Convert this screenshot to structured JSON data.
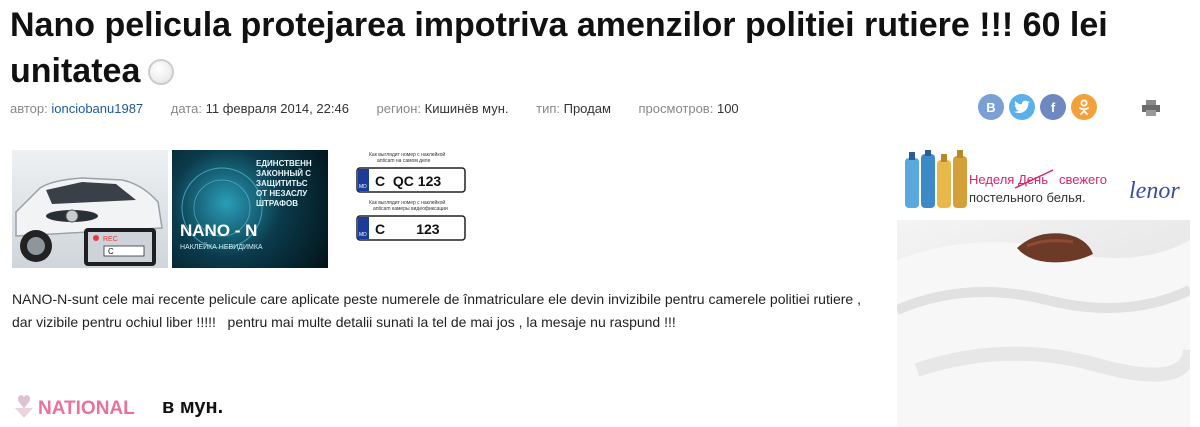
{
  "title": "Nano pelicula protejarea impotriva amenzilor politiei rutiere !!! 60 lei unitatea",
  "meta": {
    "author_label": "автор:",
    "author": "ionciobanu1987",
    "date_label": "дата:",
    "date": "11 февраля 2014, 22:46",
    "region_label": "регион:",
    "region": "Кишинёв мун.",
    "type_label": "тип:",
    "type": "Продам",
    "views_label": "просмотров:",
    "views": "100"
  },
  "share": [
    {
      "icon": "vk-icon",
      "label": "B",
      "color": "#7aa0d4"
    },
    {
      "icon": "twitter-icon",
      "label": "t",
      "color": "#5ab0e8"
    },
    {
      "icon": "facebook-icon",
      "label": "f",
      "color": "#6f88c0"
    },
    {
      "icon": "odnoklassniki-icon",
      "label": "ok",
      "color": "#f4a13b"
    }
  ],
  "images": {
    "nano_text": [
      "ЕДИНСТВЕНН",
      "ЗАКОННЫЙ С",
      "ЗАЩИТИТЬС",
      "ОТ НЕЗАСЛУ",
      "ШТРАФОВ"
    ],
    "nano_logo": "NANO - N",
    "nano_sub": "НАКЛЕЙКА НЕВИДИМКА",
    "car_plate": "C",
    "rec": "REC",
    "plate1_caption1": "Как выглядит номер с наклейкой",
    "plate1_caption2": "anticam на самом деле",
    "plate1_text": "C  QC 123",
    "plate2_caption1": "Как выглядит номер с наклейкой",
    "plate2_caption2": "anticam камеры видеофиксации",
    "plate2_text": "C        123",
    "plate_code": "MD"
  },
  "description": "NANO-N-sunt cele mai recente pelicule care aplicate peste numerele de înmatriculare ele devin invizibile pentru camerele politiei rutiere , dar vizibile pentru ochiul liber !!!!!   pentru mai multe detalii sunati la tel de mai jos , la mesaje nu raspund !!!",
  "bottom": {
    "logo_text": "NATIONAL",
    "heading": "в мун."
  },
  "ad": {
    "line1_a": "Неделя",
    "line1_strike": "День",
    "line1_b": "свежего",
    "line2": "постельного белья.",
    "brand": "lenor"
  },
  "colors": {
    "link": "#1f5a9a",
    "ad_pink": "#d6246e",
    "national_pink": "#e0457a"
  }
}
